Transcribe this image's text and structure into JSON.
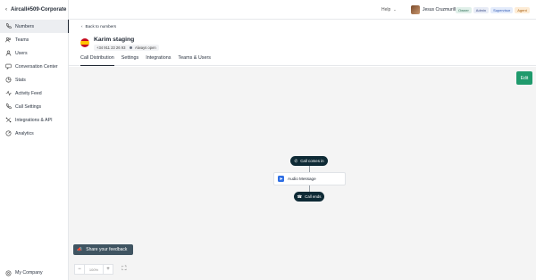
{
  "sidebar": {
    "company": "Aircall#509-Corporate",
    "items": [
      {
        "label": "Numbers",
        "icon": "phone-icon",
        "active": true
      },
      {
        "label": "Teams",
        "icon": "teams-icon"
      },
      {
        "label": "Users",
        "icon": "user-icon"
      },
      {
        "label": "Conversation Center",
        "icon": "conversation-icon"
      },
      {
        "label": "Stats",
        "icon": "stats-icon"
      },
      {
        "label": "Activity Feed",
        "icon": "activity-icon"
      },
      {
        "label": "Call Settings",
        "icon": "call-settings-icon"
      },
      {
        "label": "Integrations & API",
        "icon": "integrations-icon"
      },
      {
        "label": "Analytics",
        "icon": "analytics-icon"
      }
    ],
    "bottom": "My Company"
  },
  "topbar": {
    "help": "Help",
    "user_name": "Jesus Cruzmurillo",
    "badges": [
      "Owner",
      "Admin",
      "Supervisor",
      "Agent"
    ]
  },
  "header": {
    "back": "Back to numbers",
    "title": "Karim staging",
    "phone": "+34 911 23 26 93",
    "status": "Always open",
    "tabs": [
      "Call Distribution",
      "Settings",
      "Integrations",
      "Teams & Users"
    ]
  },
  "canvas": {
    "edit": "Edit",
    "start": "Call comes in",
    "node": "Audio Message",
    "end": "Call ends",
    "feedback": "Share your feedback",
    "zoom": "100%"
  }
}
